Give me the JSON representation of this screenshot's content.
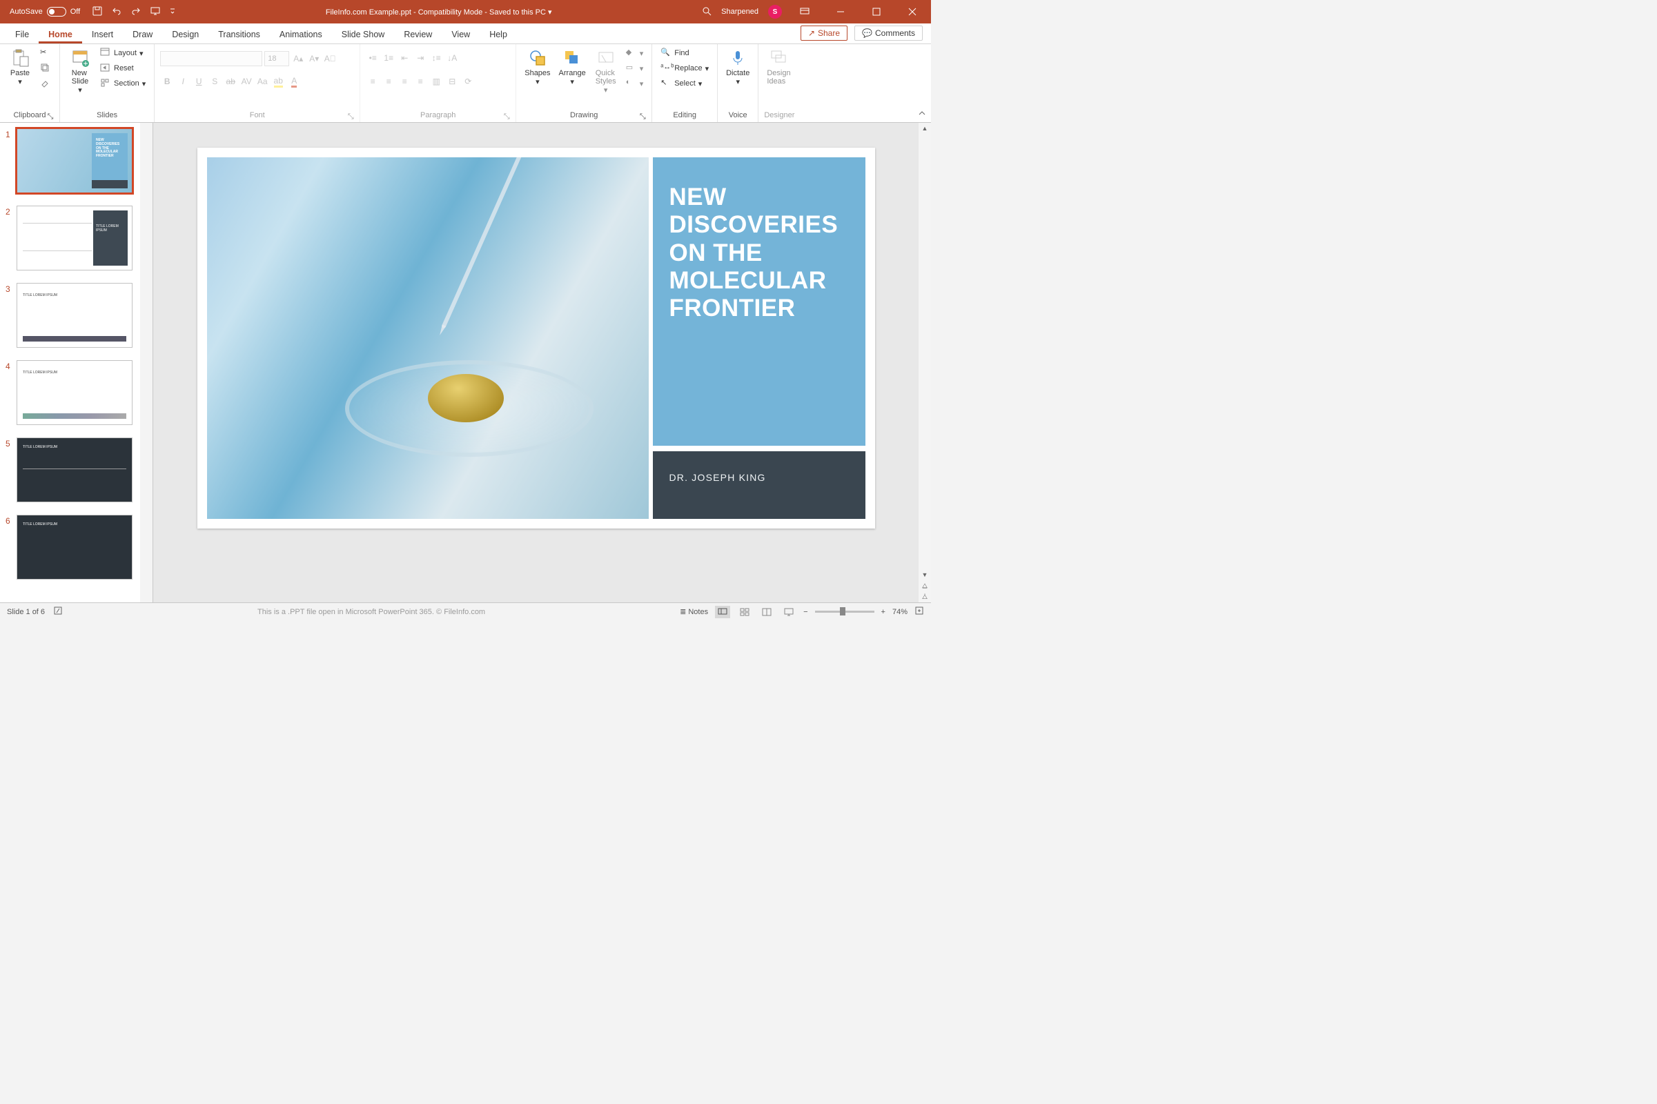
{
  "titlebar": {
    "autosave_label": "AutoSave",
    "autosave_state": "Off",
    "doc_title": "FileInfo.com Example.ppt  -  Compatibility Mode  -  Saved to this PC",
    "user": "Sharpened",
    "user_initial": "S"
  },
  "tabs": {
    "items": [
      "File",
      "Home",
      "Insert",
      "Draw",
      "Design",
      "Transitions",
      "Animations",
      "Slide Show",
      "Review",
      "View",
      "Help"
    ],
    "active": "Home",
    "share": "Share",
    "comments": "Comments"
  },
  "ribbon": {
    "clipboard": {
      "paste": "Paste",
      "label": "Clipboard"
    },
    "slides": {
      "new_slide": "New\nSlide",
      "layout": "Layout",
      "reset": "Reset",
      "section": "Section",
      "label": "Slides"
    },
    "font": {
      "size": "18",
      "label": "Font"
    },
    "paragraph": {
      "label": "Paragraph"
    },
    "drawing": {
      "shapes": "Shapes",
      "arrange": "Arrange",
      "quick_styles": "Quick\nStyles",
      "label": "Drawing"
    },
    "editing": {
      "find": "Find",
      "replace": "Replace",
      "select": "Select",
      "label": "Editing"
    },
    "voice": {
      "dictate": "Dictate",
      "label": "Voice"
    },
    "designer": {
      "design_ideas": "Design\nIdeas",
      "label": "Designer"
    }
  },
  "thumbnails": {
    "count": 6,
    "selected": 1,
    "slide1_title": "NEW DISCOVERIES ON THE MOLECULAR FRONTIER",
    "generic_title": "TITLE LOREM IPSUM"
  },
  "slide": {
    "title": "NEW DISCOVERIES ON THE MOLECULAR FRONTIER",
    "author": "DR. JOSEPH KING"
  },
  "statusbar": {
    "slide_no": "Slide 1 of 6",
    "notes": "Notes",
    "watermark": "This is a .PPT file open in Microsoft PowerPoint 365. © FileInfo.com",
    "zoom": "74%"
  }
}
